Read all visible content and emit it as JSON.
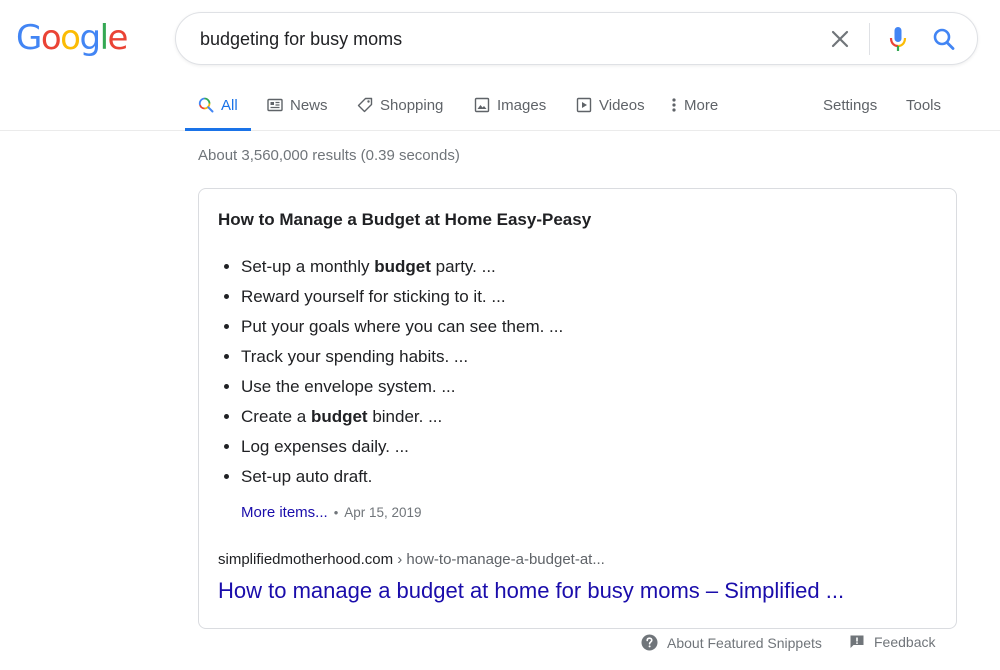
{
  "logo": {
    "letters": [
      "G",
      "o",
      "o",
      "g",
      "l",
      "e"
    ],
    "colors": [
      "#4285F4",
      "#EA4335",
      "#FBBC05",
      "#4285F4",
      "#34A853",
      "#EA4335"
    ]
  },
  "search": {
    "query": "budgeting for busy moms",
    "clear_icon": "close-icon",
    "mic_icon": "microphone-icon",
    "search_icon": "search-icon"
  },
  "tabs": [
    {
      "label": "All",
      "icon": "search-icon",
      "active": true
    },
    {
      "label": "News",
      "icon": "news-icon"
    },
    {
      "label": "Shopping",
      "icon": "tag-icon"
    },
    {
      "label": "Images",
      "icon": "image-icon"
    },
    {
      "label": "Videos",
      "icon": "video-icon"
    },
    {
      "label": "More",
      "icon": "more-vertical-icon"
    }
  ],
  "tools": {
    "settings": "Settings",
    "tools": "Tools"
  },
  "results_stats": "About 3,560,000 results (0.39 seconds)",
  "snippet": {
    "heading": "How to Manage a Budget at Home Easy-Peasy",
    "items": [
      {
        "before": "Set-up a monthly ",
        "bold": "budget",
        "after": " party. ..."
      },
      {
        "before": "Reward yourself for sticking to it. ...",
        "bold": "",
        "after": ""
      },
      {
        "before": "Put your goals where you can see them. ...",
        "bold": "",
        "after": ""
      },
      {
        "before": "Track your spending habits. ...",
        "bold": "",
        "after": ""
      },
      {
        "before": "Use the envelope system. ...",
        "bold": "",
        "after": ""
      },
      {
        "before": "Create a ",
        "bold": "budget",
        "after": " binder. ..."
      },
      {
        "before": "Log expenses daily. ...",
        "bold": "",
        "after": ""
      },
      {
        "before": "Set-up auto draft.",
        "bold": "",
        "after": ""
      }
    ],
    "more_items": "More items...",
    "separator": "•",
    "date": "Apr 15, 2019",
    "cite_domain": "simplifiedmotherhood.com",
    "cite_path": " › how-to-manage-a-budget-at...",
    "result_title": "How to manage a budget at home for busy moms – Simplified ..."
  },
  "footer": {
    "about": "About Featured Snippets",
    "feedback": "Feedback"
  },
  "colors": {
    "accent": "#1a73e8",
    "link": "#1a0dab",
    "muted": "#70757a"
  }
}
